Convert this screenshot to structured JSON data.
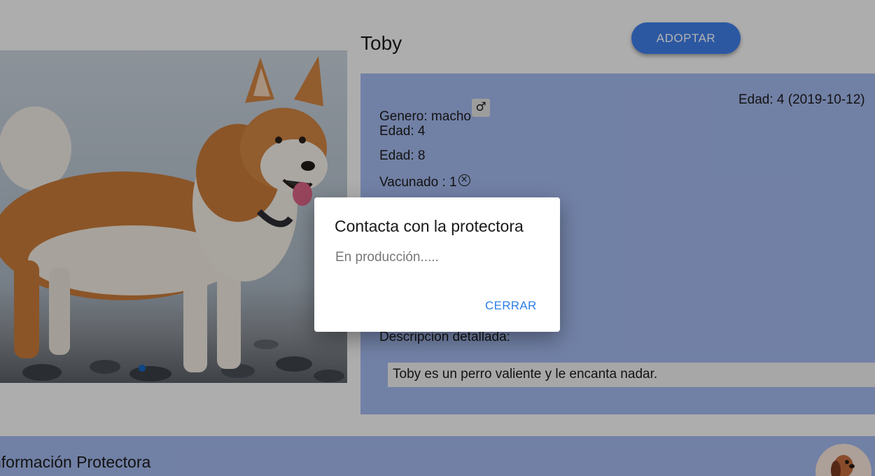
{
  "pet": {
    "name": "Toby",
    "adopt_label": "ADOPTAR",
    "gender_label": "Genero: macho",
    "gender_icon": "male-icon",
    "age_line_1": "Edad: 4",
    "age_line_2": "Edad: 8",
    "vaccinated_label": "Vacunado : 1",
    "vaccinated_icon": "circle-x-icon",
    "age_with_date": "Edad: 4 (2019-10-12)",
    "description_heading": "Descripcion detallada:",
    "description": "Toby es un perro valiente y le encanta nadar."
  },
  "footer": {
    "title": "nformación Protectora",
    "logo_icon": "dog-logo-icon"
  },
  "dialog": {
    "title": "Contacta con la protectora",
    "message": "En producción.....",
    "close_label": "CERRAR"
  },
  "colors": {
    "accent": "#3f7fe8",
    "panel": "#a3b8ec",
    "dialog_button": "#2f7fe8",
    "carousel_dot": "#1565c0"
  }
}
